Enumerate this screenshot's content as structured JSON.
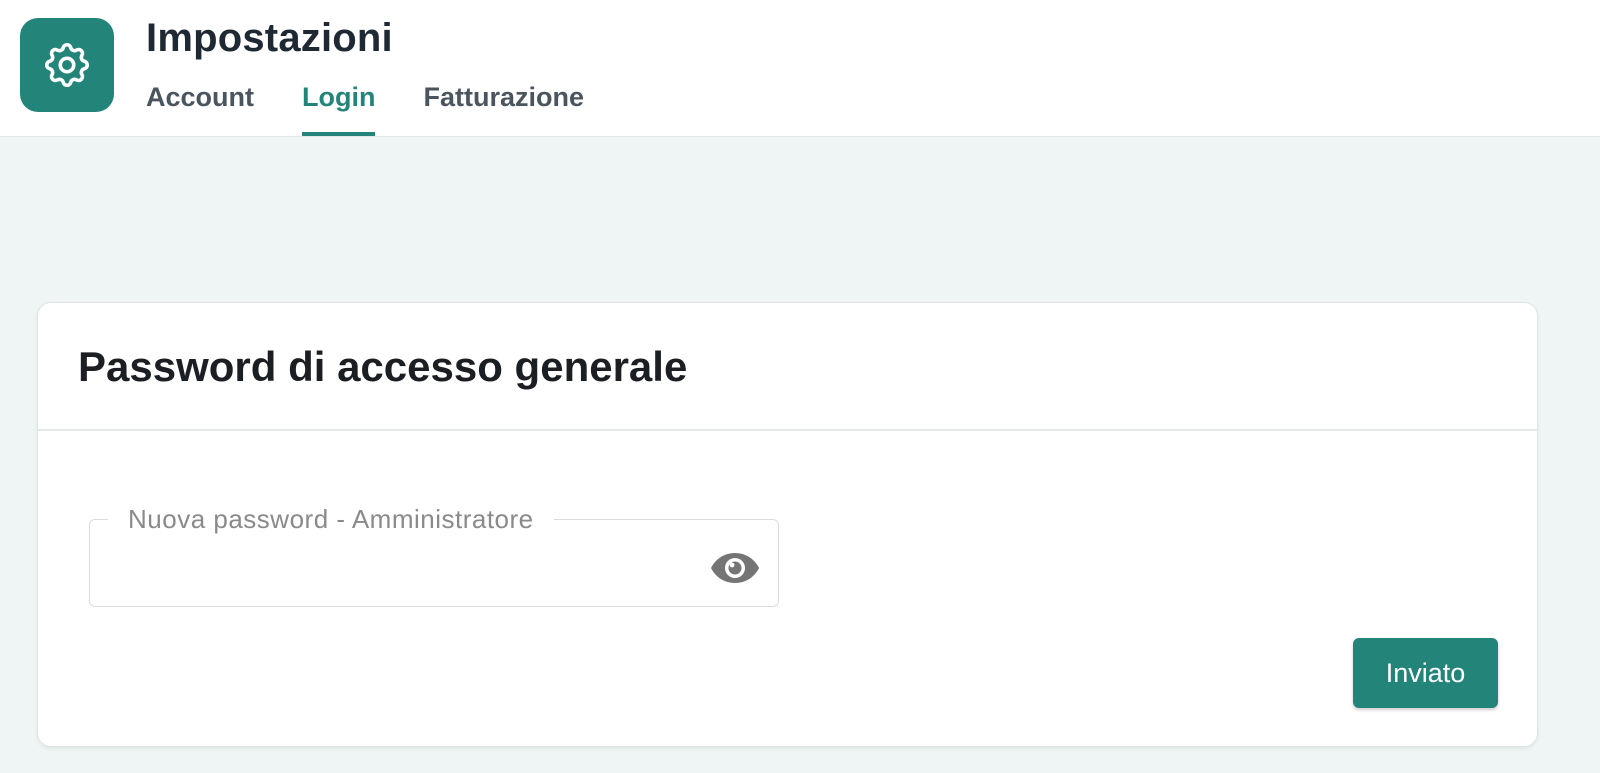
{
  "app": {
    "title": "Impostazioni",
    "icon": "gear-icon",
    "accent_color": "#23857a"
  },
  "tabs": [
    {
      "label": "Account",
      "active": false
    },
    {
      "label": "Login",
      "active": true
    },
    {
      "label": "Fatturazione",
      "active": false
    }
  ],
  "card": {
    "title": "Password di accesso generale",
    "password_field": {
      "label": "Nuova password - Amministratore",
      "value": "",
      "toggle_icon": "eye-icon"
    },
    "submit_label": "Inviato"
  }
}
